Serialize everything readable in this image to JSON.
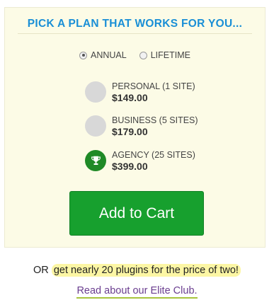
{
  "header": {
    "title": "PICK A PLAN THAT WORKS FOR YOU..."
  },
  "billing": {
    "options": [
      {
        "label": "ANNUAL",
        "checked": true
      },
      {
        "label": "LIFETIME",
        "checked": false
      }
    ]
  },
  "plans": [
    {
      "name": "PERSONAL (1 SITE)",
      "price": "$149.00",
      "selected": false
    },
    {
      "name": "BUSINESS (5 SITES)",
      "price": "$179.00",
      "selected": false
    },
    {
      "name": "AGENCY (25 SITES)",
      "price": "$399.00",
      "selected": true,
      "icon": "trophy-icon"
    }
  ],
  "cart": {
    "label": "Add to Cart"
  },
  "promo": {
    "prefix": "OR",
    "highlight": "get nearly 20 plugins for the price of two!",
    "link": "Read about our Elite Club."
  },
  "colors": {
    "panel_bg": "#fcfbe6",
    "title": "#1a8fd6",
    "cart_button": "#17a02e",
    "selected_plan": "#1f8a26",
    "highlight": "#fcf6a4",
    "link": "#6a3d8f"
  }
}
